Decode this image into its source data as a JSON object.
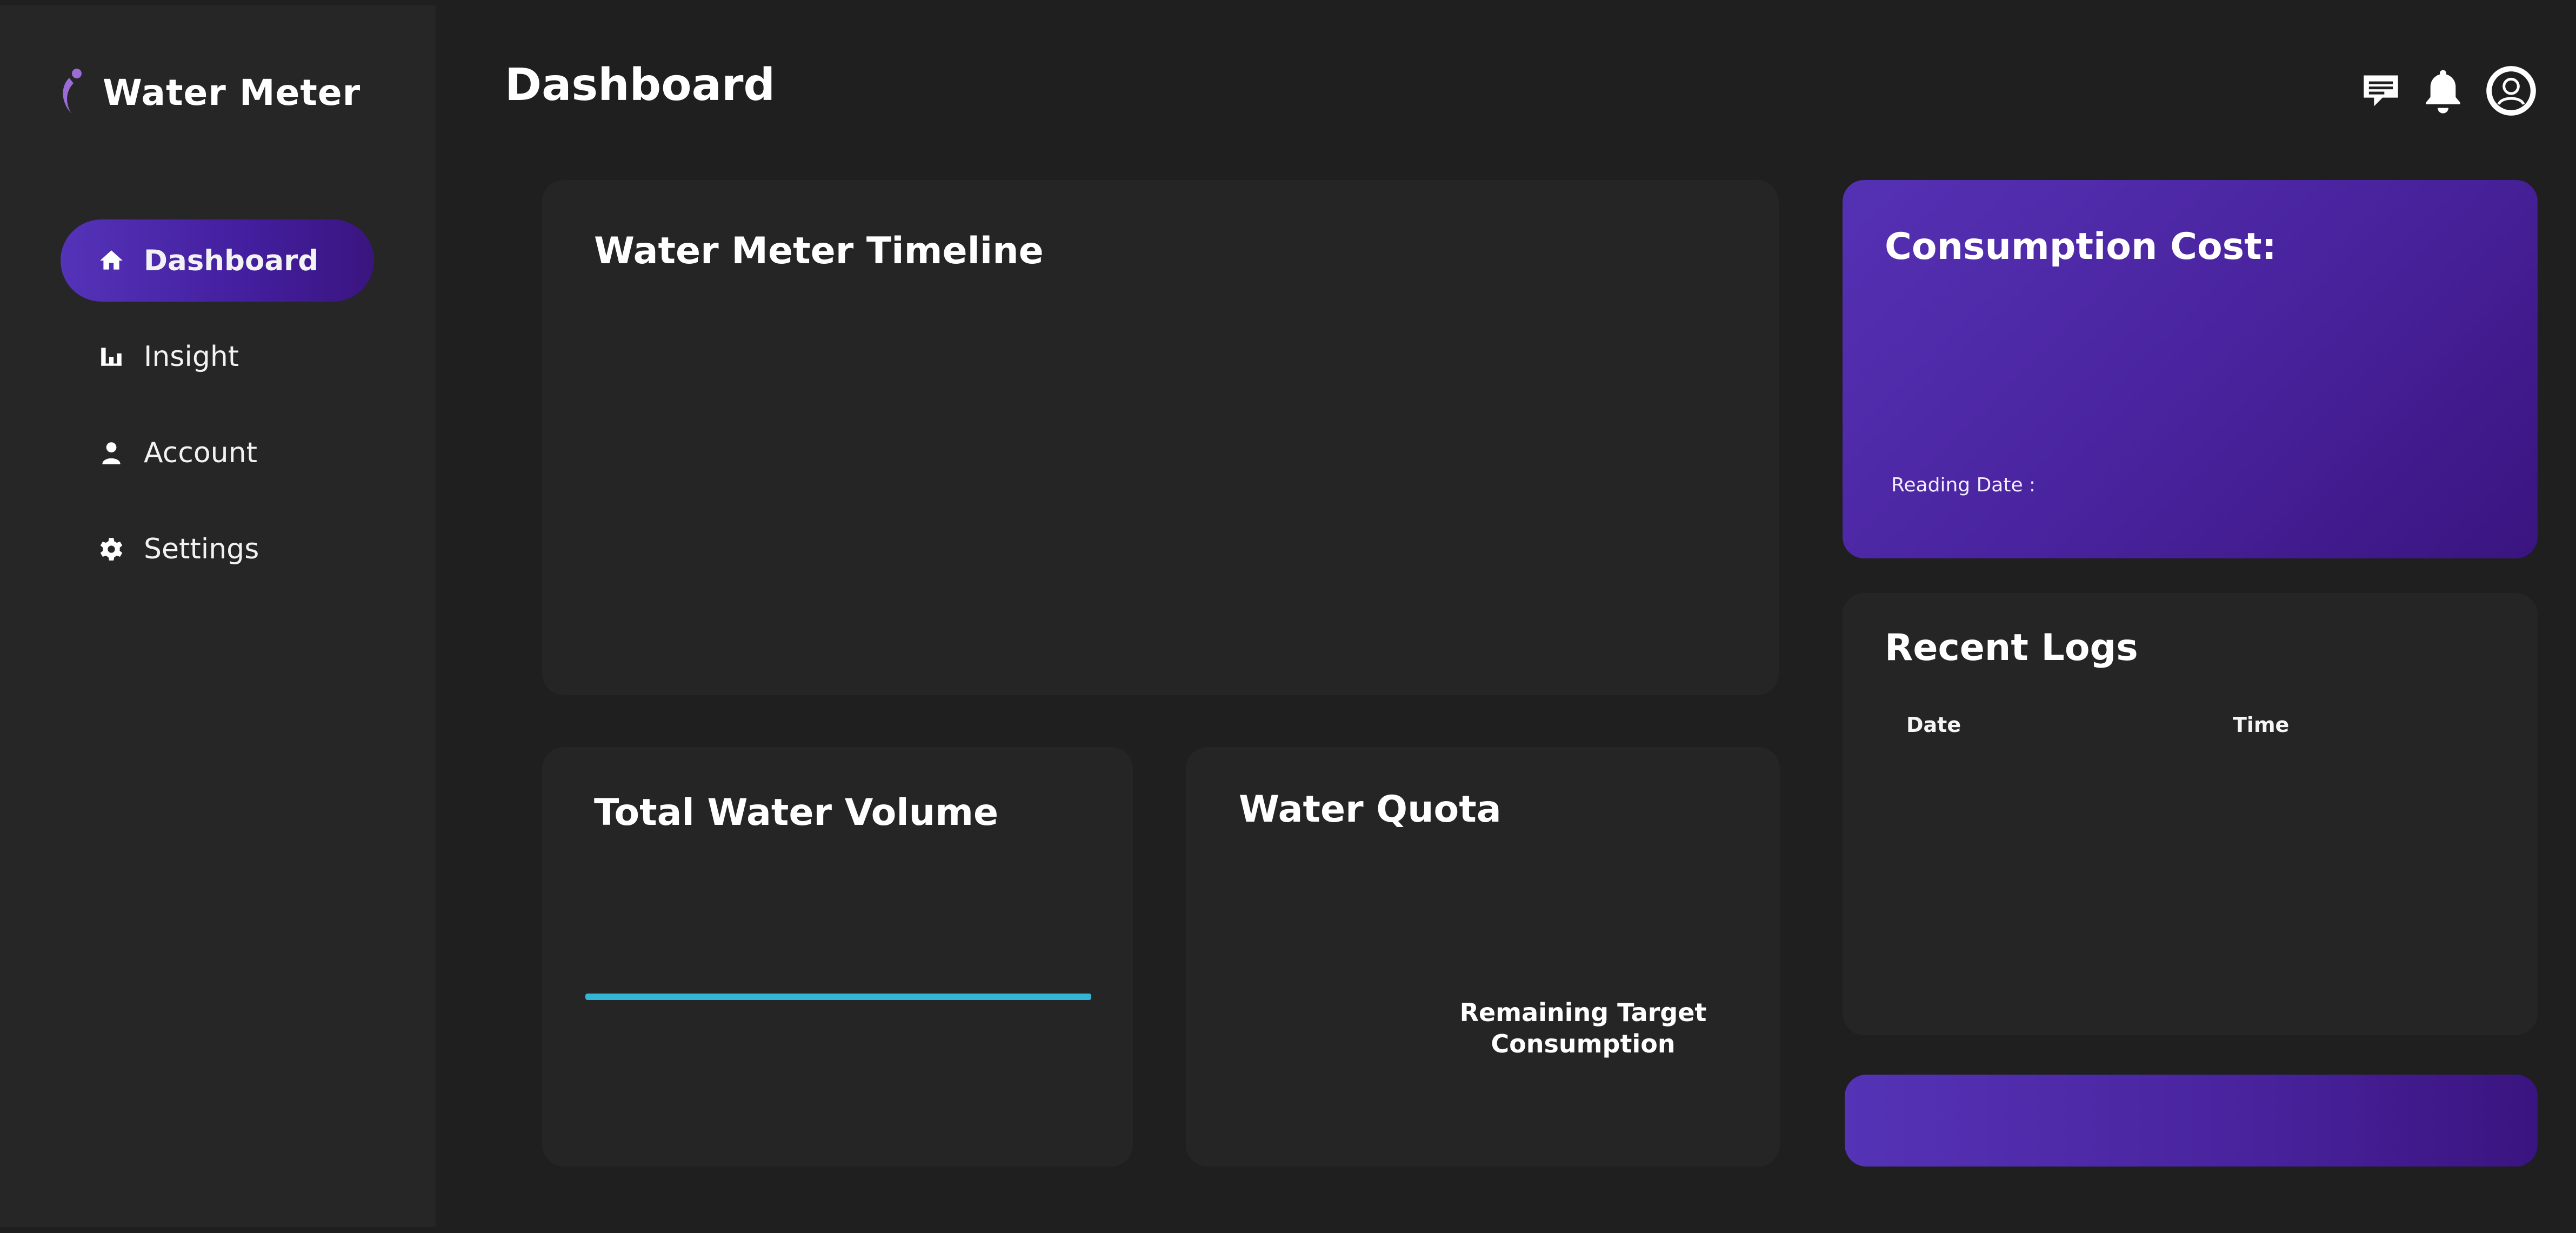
{
  "brand": {
    "name": "Water Meter",
    "logo_icon": "water-drop-logo-icon",
    "accent_color": "#9b6bd6"
  },
  "sidebar": {
    "items": [
      {
        "label": "Dashboard",
        "icon": "home-icon",
        "active": true
      },
      {
        "label": "Insight",
        "icon": "bar-chart-icon",
        "active": false
      },
      {
        "label": "Account",
        "icon": "user-icon",
        "active": false
      },
      {
        "label": "Settings",
        "icon": "gear-icon",
        "active": false
      }
    ],
    "active_gradient": [
      "#5533b8",
      "#3a157f"
    ]
  },
  "header": {
    "title": "Dashboard",
    "icons": [
      "message-icon",
      "bell-icon",
      "profile-icon"
    ]
  },
  "timeline": {
    "title": "Water Meter Timeline"
  },
  "volume": {
    "title": "Total Water Volume",
    "progress_fraction": 1.0,
    "bar_color": "#33b6d6"
  },
  "quota": {
    "title": "Water Quota",
    "caption_line1": "Remaining Target",
    "caption_line2": "Consumption"
  },
  "cost": {
    "title": "Consumption Cost:",
    "reading_date_label": "Reading Date :",
    "gradient": [
      "#5531b4",
      "#3a147f"
    ]
  },
  "logs": {
    "title": "Recent Logs",
    "columns": [
      "Date",
      "Time"
    ],
    "rows": []
  },
  "colors": {
    "background": "#1f1f1f",
    "sidebar": "#262626",
    "card": "#252525",
    "text": "#ffffff"
  }
}
